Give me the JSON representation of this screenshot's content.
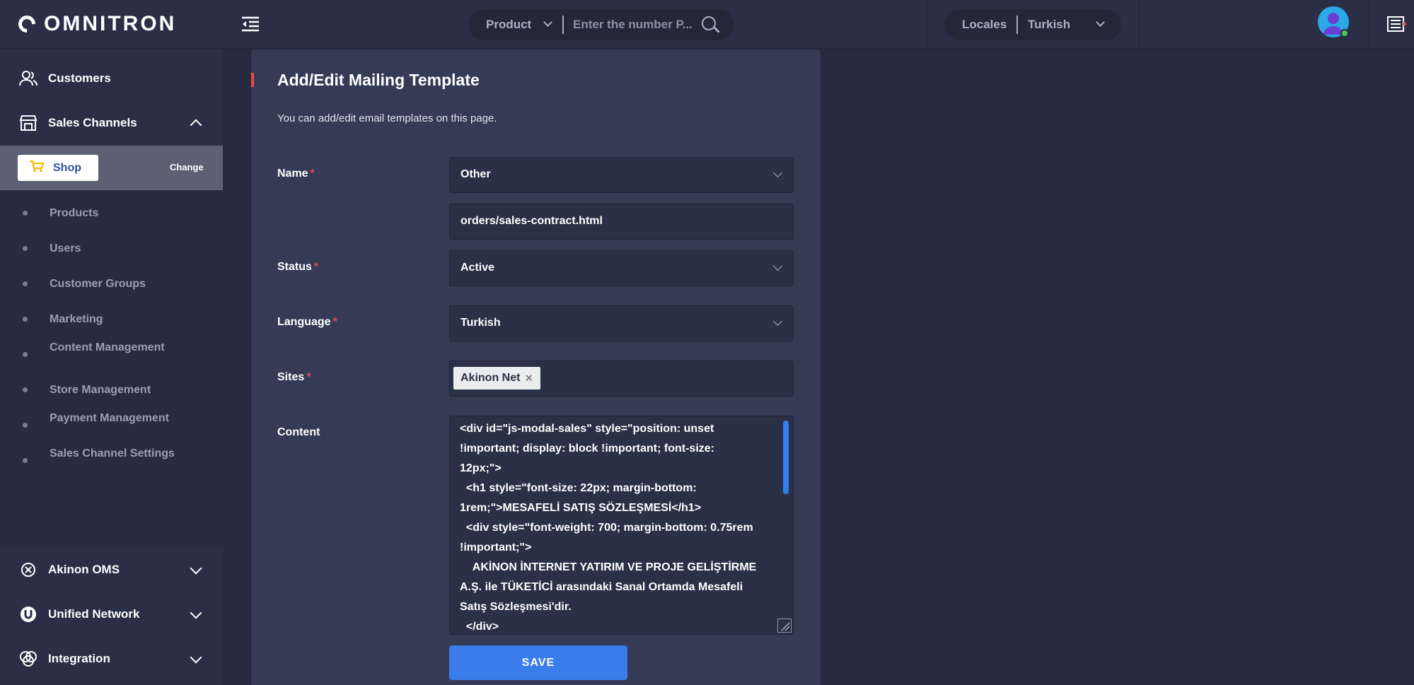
{
  "brand": {
    "name": "OMNITRON"
  },
  "sidebar": {
    "customers": "Customers",
    "sales_channels": "Sales Channels",
    "shop": {
      "label": "Shop",
      "change": "Change"
    },
    "sub_items": [
      "Products",
      "Users",
      "Customer Groups",
      "Marketing",
      "Content Management",
      "Store Management",
      "Payment Management",
      "Sales Channel Settings"
    ],
    "akinon_oms": "Akinon OMS",
    "unified_network": "Unified Network",
    "integration": "Integration"
  },
  "topbar": {
    "search_category": "Product",
    "search_placeholder": "Enter the number P...",
    "locales_label": "Locales",
    "locale_value": "Turkish"
  },
  "form": {
    "title": "Add/Edit Mailing Template",
    "description": "You can add/edit email templates on this page.",
    "name_label": "Name",
    "name_value": "Other",
    "path_value": "orders/sales-contract.html",
    "status_label": "Status",
    "status_value": "Active",
    "language_label": "Language",
    "language_value": "Turkish",
    "sites_label": "Sites",
    "site_tag": "Akinon Net",
    "content_label": "Content",
    "content_value": "<div id=\"js-modal-sales\" style=\"position: unset !important; display: block !important; font-size: 12px;\">\n  <h1 style=\"font-size: 22px; margin-bottom: 1rem;\">MESAFELİ SATIŞ SÖZLEŞMESİ</h1>\n  <div style=\"font-weight: 700; margin-bottom: 0.75rem !important;\">\n    AKİNON İNTERNET YATIRIM VE PROJE GELİŞTİRME A.Ş. ile TÜKETİCİ arasındaki Sanal Ortamda Mesafeli Satış Sözleşmesi'dir.\n  </div>",
    "required_mark": "*",
    "save": "SAVE"
  },
  "colors": {
    "accent": "#e8484f",
    "primary_button": "#3a7dea",
    "sidebar_bg": "#2a2f45",
    "card_bg": "#353b55"
  }
}
